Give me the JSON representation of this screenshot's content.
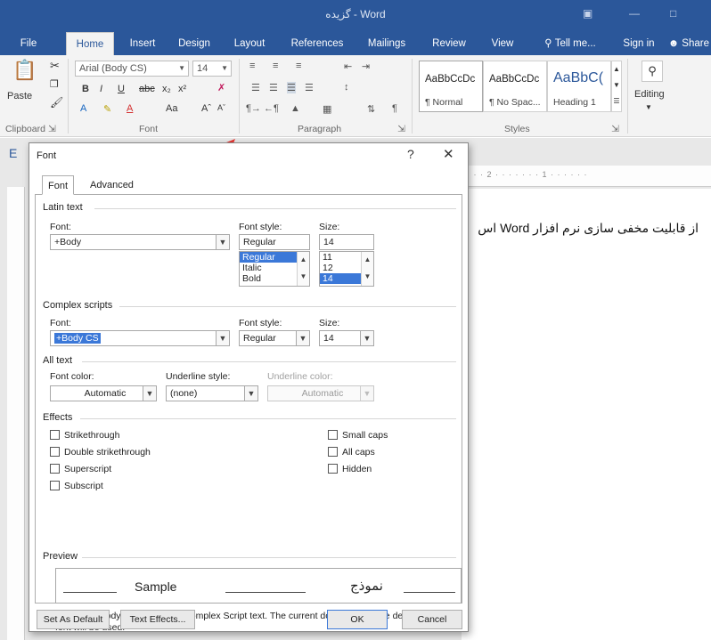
{
  "window": {
    "title": "گزیده - Word"
  },
  "tabs": [
    {
      "label": "File"
    },
    {
      "label": "Home"
    },
    {
      "label": "Insert"
    },
    {
      "label": "Design"
    },
    {
      "label": "Layout"
    },
    {
      "label": "References"
    },
    {
      "label": "Mailings"
    },
    {
      "label": "Review"
    },
    {
      "label": "View"
    },
    {
      "label": "Tell me..."
    },
    {
      "label": "Sign in"
    },
    {
      "label": "Share"
    }
  ],
  "ribbon": {
    "paste_label": "Paste",
    "font_name": "Arial (Body CS)",
    "font_size": "14",
    "clipboard_label": "Clipboard",
    "font_group_label": "Font",
    "paragraph_label": "Paragraph",
    "styles_label": "Styles",
    "editing_label": "Editing",
    "styles": [
      {
        "sample": "AaBbCcDc",
        "name": "¶ Normal"
      },
      {
        "sample": "AaBbCcDc",
        "name": "¶ No Spac..."
      },
      {
        "sample": "AaBbC(",
        "name": "Heading 1"
      }
    ]
  },
  "document": {
    "text": "از قابلیت مخفی سازی نرم افزار Word اس"
  },
  "dialog": {
    "title": "Font",
    "help": "?",
    "close": "✕",
    "tabs": [
      {
        "label": "Font"
      },
      {
        "label": "Advanced"
      }
    ],
    "latin": {
      "section": "Latin text",
      "font_label": "Font:",
      "font_value": "+Body",
      "style_label": "Font style:",
      "style_value": "Regular",
      "style_options": [
        "Regular",
        "Italic",
        "Bold"
      ],
      "size_label": "Size:",
      "size_value": "14",
      "size_options": [
        "11",
        "12",
        "14"
      ]
    },
    "complex": {
      "section": "Complex scripts",
      "font_label": "Font:",
      "font_value": "+Body CS",
      "style_label": "Font style:",
      "style_value": "Regular",
      "size_label": "Size:",
      "size_value": "14"
    },
    "alltext": {
      "section": "All text",
      "color_label": "Font color:",
      "color_value": "Automatic",
      "underline_label": "Underline style:",
      "underline_value": "(none)",
      "ucolor_label": "Underline color:",
      "ucolor_value": "Automatic"
    },
    "effects": {
      "section": "Effects",
      "left": [
        "Strikethrough",
        "Double strikethrough",
        "Superscript",
        "Subscript"
      ],
      "right": [
        "Small caps",
        "All caps",
        "Hidden"
      ]
    },
    "preview": {
      "section": "Preview",
      "sample": "Sample",
      "arabic": "نموذج",
      "description": "This is the body theme font for Complex Script text. The current document theme defines which font will be used."
    },
    "buttons": {
      "set_default": "Set As Default",
      "text_effects": "Text Effects...",
      "ok": "OK",
      "cancel": "Cancel"
    }
  },
  "colors": {
    "word_blue": "#2b579a",
    "highlight_red": "#e53935",
    "selection_blue": "#3b78d8"
  }
}
